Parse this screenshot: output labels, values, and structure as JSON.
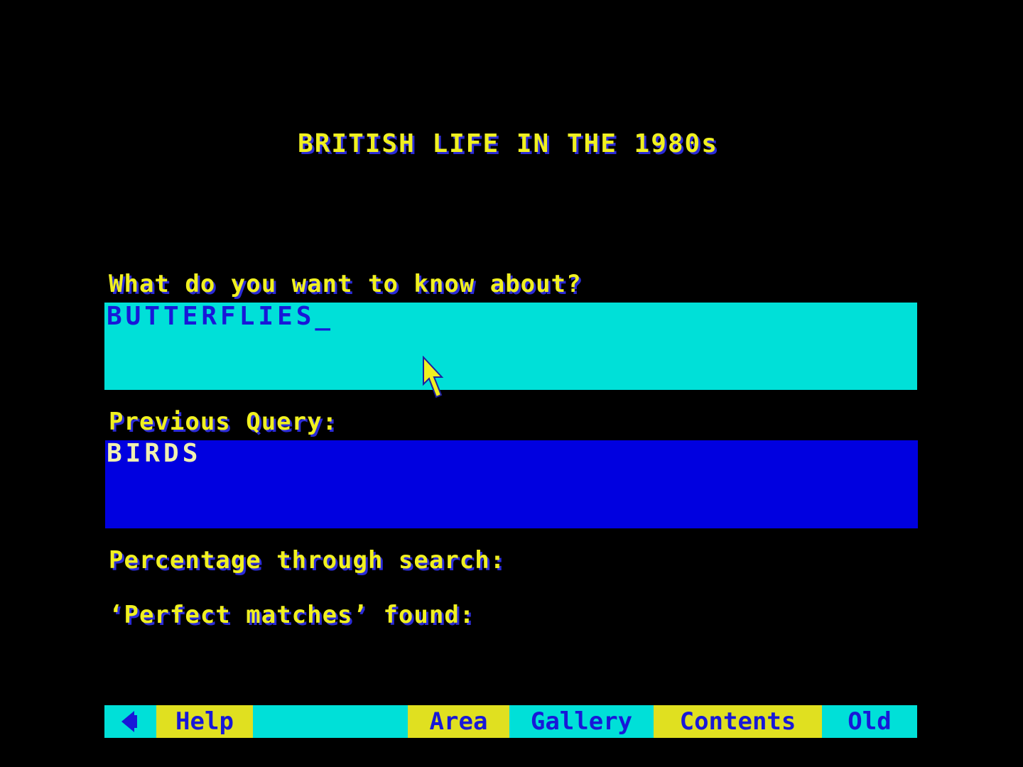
{
  "title": "BRITISH LIFE IN THE 1980s",
  "query": {
    "prompt": "What do you want to know about?",
    "value": "BUTTERFLIES_"
  },
  "previous": {
    "label": "Previous Query:",
    "value": "BIRDS"
  },
  "progress": {
    "label": "Percentage through search:"
  },
  "matches": {
    "label": "‘Perfect matches’ found:"
  },
  "menu": {
    "back_icon": "left-arrow-icon",
    "help": "Help",
    "area": "Area",
    "gallery": "Gallery",
    "contents": "Contents",
    "old": "Old"
  },
  "colors": {
    "background": "#000000",
    "label_yellow": "#f0f020",
    "cyan": "#00e0d8",
    "blue": "#0000e0",
    "menu_yellow": "#e0e020"
  }
}
